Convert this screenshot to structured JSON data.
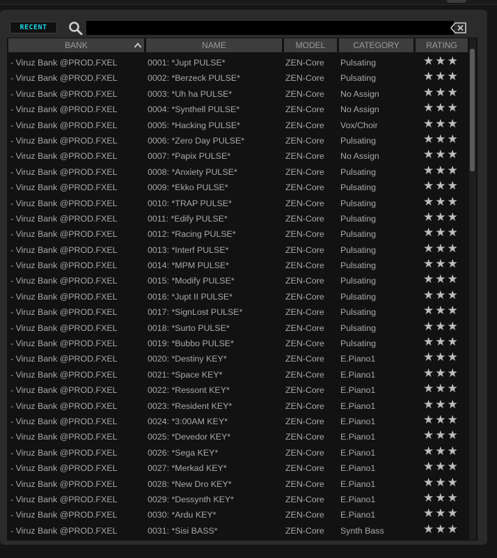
{
  "toolbar": {
    "recent_label": "RECENT",
    "search_value": "",
    "search_icon": "search-icon",
    "clear_icon": "backspace-clear-icon"
  },
  "colors": {
    "accent": "#1ad3e3",
    "panel": "#2b2b2b",
    "list_bg": "#121212",
    "header_bg": "#3d3d3d",
    "text": "#a9a9a9"
  },
  "columns": {
    "bank": "BANK",
    "name": "NAME",
    "model": "MODEL",
    "category": "CATEGORY",
    "rating": "RATING"
  },
  "sort": {
    "column": "BANK",
    "direction": "ascending",
    "icon": "chevron-up-icon"
  },
  "rating_glyphs": "★★★",
  "rows": [
    {
      "bank": "- Viruz Bank @PROD.FXEL",
      "name": "0001: *Jupt PULSE*",
      "model": "ZEN-Core",
      "category": "Pulsating"
    },
    {
      "bank": "- Viruz Bank @PROD.FXEL",
      "name": "0002: *Berzeck PULSE*",
      "model": "ZEN-Core",
      "category": "Pulsating"
    },
    {
      "bank": "- Viruz Bank @PROD.FXEL",
      "name": "0003: *Uh ha PULSE*",
      "model": "ZEN-Core",
      "category": "No Assign"
    },
    {
      "bank": "- Viruz Bank @PROD.FXEL",
      "name": "0004: *Synthell PULSE*",
      "model": "ZEN-Core",
      "category": "No Assign"
    },
    {
      "bank": "- Viruz Bank @PROD.FXEL",
      "name": "0005: *Hacking PULSE*",
      "model": "ZEN-Core",
      "category": "Vox/Choir"
    },
    {
      "bank": "- Viruz Bank @PROD.FXEL",
      "name": "0006: *Zero Day PULSE*",
      "model": "ZEN-Core",
      "category": "Pulsating"
    },
    {
      "bank": "- Viruz Bank @PROD.FXEL",
      "name": "0007: *Papix PULSE*",
      "model": "ZEN-Core",
      "category": "No Assign"
    },
    {
      "bank": "- Viruz Bank @PROD.FXEL",
      "name": "0008: *Anxiety PULSE*",
      "model": "ZEN-Core",
      "category": "Pulsating"
    },
    {
      "bank": "- Viruz Bank @PROD.FXEL",
      "name": "0009: *Ekko PULSE*",
      "model": "ZEN-Core",
      "category": "Pulsating"
    },
    {
      "bank": "- Viruz Bank @PROD.FXEL",
      "name": "0010: *TRAP PULSE*",
      "model": "ZEN-Core",
      "category": "Pulsating"
    },
    {
      "bank": "- Viruz Bank @PROD.FXEL",
      "name": "0011: *Edify PULSE*",
      "model": "ZEN-Core",
      "category": "Pulsating"
    },
    {
      "bank": "- Viruz Bank @PROD.FXEL",
      "name": "0012: *Racing PULSE*",
      "model": "ZEN-Core",
      "category": "Pulsating"
    },
    {
      "bank": "- Viruz Bank @PROD.FXEL",
      "name": "0013: *Interf PULSE*",
      "model": "ZEN-Core",
      "category": "Pulsating"
    },
    {
      "bank": "- Viruz Bank @PROD.FXEL",
      "name": "0014: *MPM PULSE*",
      "model": "ZEN-Core",
      "category": "Pulsating"
    },
    {
      "bank": "- Viruz Bank @PROD.FXEL",
      "name": "0015: *Modify PULSE*",
      "model": "ZEN-Core",
      "category": "Pulsating"
    },
    {
      "bank": "- Viruz Bank @PROD.FXEL",
      "name": "0016: *Jupt II PULSE*",
      "model": "ZEN-Core",
      "category": "Pulsating"
    },
    {
      "bank": "- Viruz Bank @PROD.FXEL",
      "name": "0017: *SignLost PULSE*",
      "model": "ZEN-Core",
      "category": "Pulsating"
    },
    {
      "bank": "- Viruz Bank @PROD.FXEL",
      "name": "0018: *Surto PULSE*",
      "model": "ZEN-Core",
      "category": "Pulsating"
    },
    {
      "bank": "- Viruz Bank @PROD.FXEL",
      "name": "0019: *Bubbo PULSE*",
      "model": "ZEN-Core",
      "category": "Pulsating"
    },
    {
      "bank": "- Viruz Bank @PROD.FXEL",
      "name": "0020: *Destiny KEY*",
      "model": "ZEN-Core",
      "category": "E.Piano1"
    },
    {
      "bank": "- Viruz Bank @PROD.FXEL",
      "name": "0021: *Space KEY*",
      "model": "ZEN-Core",
      "category": "E.Piano1"
    },
    {
      "bank": "- Viruz Bank @PROD.FXEL",
      "name": "0022: *Ressont KEY*",
      "model": "ZEN-Core",
      "category": "E.Piano1"
    },
    {
      "bank": "- Viruz Bank @PROD.FXEL",
      "name": "0023: *Resident KEY*",
      "model": "ZEN-Core",
      "category": "E.Piano1"
    },
    {
      "bank": "- Viruz Bank @PROD.FXEL",
      "name": "0024: *3:00AM KEY*",
      "model": "ZEN-Core",
      "category": "E.Piano1"
    },
    {
      "bank": "- Viruz Bank @PROD.FXEL",
      "name": "0025: *Devedor KEY*",
      "model": "ZEN-Core",
      "category": "E.Piano1"
    },
    {
      "bank": "- Viruz Bank @PROD.FXEL",
      "name": "0026: *Sega KEY*",
      "model": "ZEN-Core",
      "category": "E.Piano1"
    },
    {
      "bank": "- Viruz Bank @PROD.FXEL",
      "name": "0027: *Merkad KEY*",
      "model": "ZEN-Core",
      "category": "E.Piano1"
    },
    {
      "bank": "- Viruz Bank @PROD.FXEL",
      "name": "0028: *New Dro KEY*",
      "model": "ZEN-Core",
      "category": "E.Piano1"
    },
    {
      "bank": "- Viruz Bank @PROD.FXEL",
      "name": "0029: *Dessynth KEY*",
      "model": "ZEN-Core",
      "category": "E.Piano1"
    },
    {
      "bank": "- Viruz Bank @PROD.FXEL",
      "name": "0030: *Ardu KEY*",
      "model": "ZEN-Core",
      "category": "E.Piano1"
    },
    {
      "bank": "- Viruz Bank @PROD.FXEL",
      "name": "0031: *Sisi BASS*",
      "model": "ZEN-Core",
      "category": "Synth Bass"
    }
  ]
}
